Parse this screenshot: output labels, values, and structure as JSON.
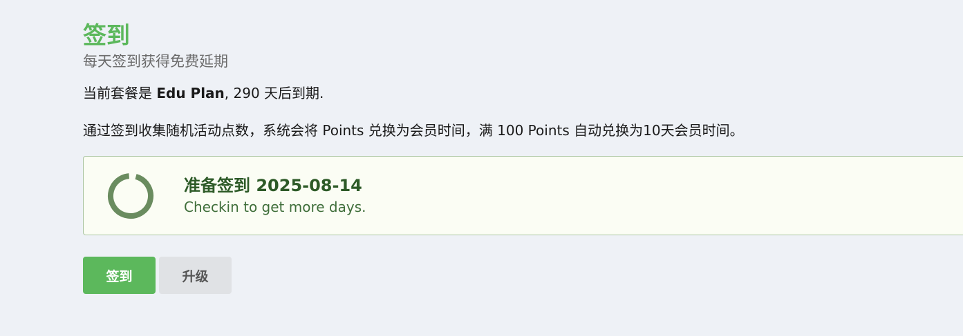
{
  "header": {
    "title": "签到",
    "subtitle": "每天签到获得免费延期"
  },
  "plan": {
    "prefix": "当前套餐是 ",
    "name": "Edu Plan",
    "suffix": ", 290 天后到期."
  },
  "info": {
    "text": "通过签到收集随机活动点数，系统会将 Points 兑换为会员时间，满 100 Points 自动兑换为10天会员时间。"
  },
  "status": {
    "title": "准备签到 2025-08-14",
    "subtitle": "Checkin to get more days.",
    "icon": "progress-ring-icon",
    "ring_color": "#6a8c5f"
  },
  "actions": {
    "checkin_label": "签到",
    "upgrade_label": "升级"
  },
  "colors": {
    "accent": "#5cb85c",
    "card_border": "#a9c4a0",
    "card_bg": "#fbfdf4"
  }
}
